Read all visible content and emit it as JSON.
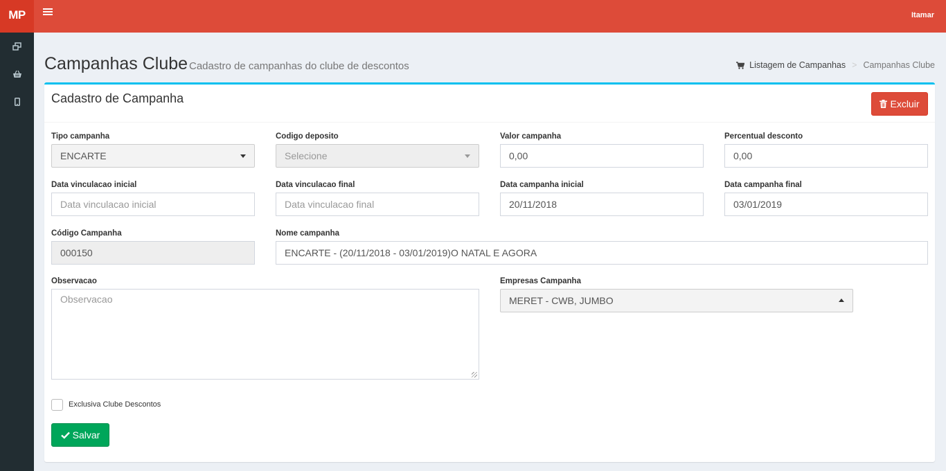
{
  "header": {
    "logo": "MP",
    "user": "Itamar",
    "menu_icon": "hamburger-icon"
  },
  "sidebar": {
    "items": [
      {
        "icon": "windows-icon"
      },
      {
        "icon": "basket-icon"
      },
      {
        "icon": "mobile-icon"
      }
    ]
  },
  "page": {
    "title": "Campanhas Clube",
    "subtitle": "Cadastro de campanhas do clube de descontos"
  },
  "breadcrumb": {
    "link": "Listagem de Campanhas",
    "separator": ">",
    "current": "Campanhas Clube"
  },
  "form": {
    "title": "Cadastro de Campanha",
    "delete_label": "Excluir",
    "save_label": "Salvar",
    "tipo_campanha": {
      "label": "Tipo campanha",
      "value": "ENCARTE"
    },
    "codigo_deposito": {
      "label": "Codigo deposito",
      "value": "Selecione"
    },
    "valor_campanha": {
      "label": "Valor campanha",
      "value": "0,00"
    },
    "percentual_desconto": {
      "label": "Percentual desconto",
      "value": "0,00"
    },
    "data_vinculacao_inicial": {
      "label": "Data vinculacao inicial",
      "placeholder": "Data vinculacao inicial"
    },
    "data_vinculacao_final": {
      "label": "Data vinculacao final",
      "placeholder": "Data vinculacao final"
    },
    "data_campanha_inicial": {
      "label": "Data campanha inicial",
      "value": "20/11/2018"
    },
    "data_campanha_final": {
      "label": "Data campanha final",
      "value": "03/01/2019"
    },
    "codigo_campanha": {
      "label": "Código Campanha",
      "value": "000150"
    },
    "nome_campanha": {
      "label": "Nome campanha",
      "value": "ENCARTE - (20/11/2018 - 03/01/2019)O NATAL E AGORA"
    },
    "observacao": {
      "label": "Observacao",
      "placeholder": "Observacao"
    },
    "empresas_campanha": {
      "label": "Empresas Campanha",
      "value": "MERET - CWB, JUMBO"
    },
    "exclusiva": {
      "label": "Exclusiva Clube Descontos",
      "checked": false
    }
  },
  "colors": {
    "header": "#dd4b39",
    "sidebar": "#222d32",
    "box_border": "#00c0ef",
    "danger": "#dd4b39",
    "success": "#00a65a"
  }
}
